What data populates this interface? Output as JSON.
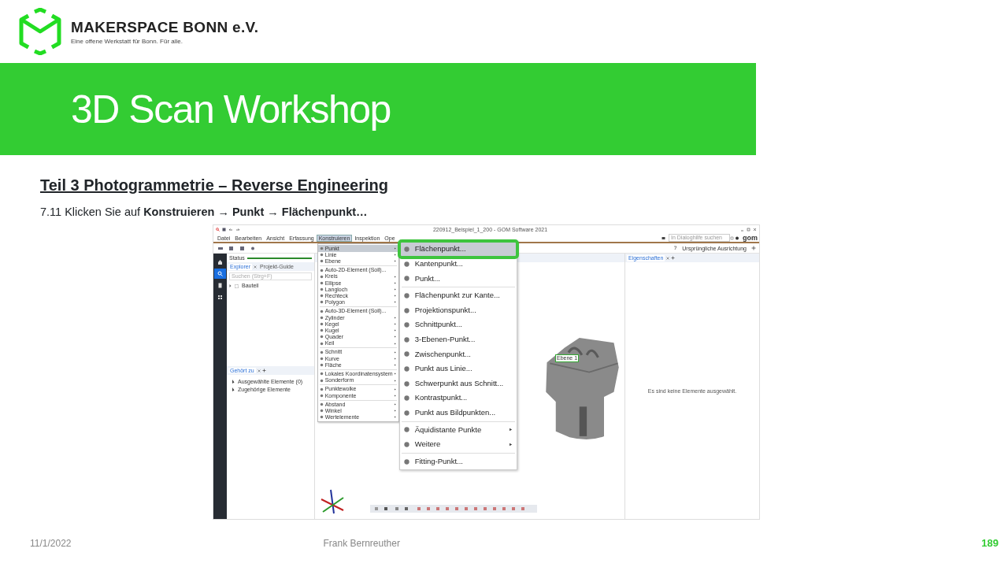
{
  "header": {
    "org_name": "MAKERSPACE BONN e.V.",
    "tagline": "Eine offene Werkstatt für Bonn. Für alle."
  },
  "banner": {
    "title": "3D Scan Workshop"
  },
  "section_heading": "Teil 3  Photogrammetrie  – Reverse Engineering",
  "instruction": "7.11 Klicken Sie auf **Konstruieren** → **Punkt** → **Flächenpunkt…**",
  "app": {
    "title": "220912_Beispiel_1_200 - GOM Software 2021",
    "menus": [
      {
        "label": "Datei",
        "selected": false
      },
      {
        "label": "Bearbeiten",
        "selected": false
      },
      {
        "label": "Ansicht",
        "selected": false
      },
      {
        "label": "Erfassung",
        "selected": false
      },
      {
        "label": "Konstruieren",
        "selected": true
      },
      {
        "label": "Inspektion",
        "selected": false
      },
      {
        "label": "Ope",
        "selected": false
      }
    ],
    "help_search": {
      "placeholder": "In Dialoghilfe suchen"
    },
    "brand": "gom",
    "alignment": "Ursprüngliche Ausrichtung",
    "sidebar": [
      {
        "kind": "home",
        "selected": false
      },
      {
        "kind": "search",
        "selected": true
      },
      {
        "kind": "document",
        "selected": false
      },
      {
        "kind": "grid",
        "selected": false
      }
    ],
    "status": {
      "label": "Status",
      "level": 1
    },
    "explorer_tabs": [
      {
        "label": "Explorer",
        "selected": true,
        "closable": true
      },
      {
        "label": "Projekt-Guide",
        "selected": false,
        "closable": false
      }
    ],
    "explorer_search": {
      "placeholder": "Suchen (Strg+F)"
    },
    "tree": [
      {
        "label": "Bauteil",
        "expanded": false
      }
    ],
    "related_tab": {
      "label": "Gehört zu"
    },
    "related_items": [
      "Ausgewählte Elemente (0)",
      "Zugehörige Elemente"
    ],
    "properties_tab": {
      "label": "Eigenschaften"
    },
    "properties_message": "Es sind keine Elemente ausgewählt.",
    "model_label": "Ebene 1",
    "construct_menu": [
      [
        {
          "label": "Punkt",
          "selected": true,
          "submenu": true
        },
        {
          "label": "Linie",
          "selected": false,
          "submenu": true
        },
        {
          "label": "Ebene",
          "selected": false,
          "submenu": true
        }
      ],
      [
        {
          "label": "Auto-2D-Element (Soll)...",
          "selected": false,
          "submenu": false
        },
        {
          "label": "Kreis",
          "selected": false,
          "submenu": true
        },
        {
          "label": "Ellipse",
          "selected": false,
          "submenu": true
        },
        {
          "label": "Langloch",
          "selected": false,
          "submenu": true
        },
        {
          "label": "Rechteck",
          "selected": false,
          "submenu": true
        },
        {
          "label": "Polygon",
          "selected": false,
          "submenu": true
        }
      ],
      [
        {
          "label": "Auto-3D-Element (Soll)...",
          "selected": false,
          "submenu": false
        },
        {
          "label": "Zylinder",
          "selected": false,
          "submenu": true
        },
        {
          "label": "Kegel",
          "selected": false,
          "submenu": true
        },
        {
          "label": "Kugel",
          "selected": false,
          "submenu": true
        },
        {
          "label": "Quader",
          "selected": false,
          "submenu": true
        },
        {
          "label": "Keil",
          "selected": false,
          "submenu": true
        }
      ],
      [
        {
          "label": "Schnitt",
          "selected": false,
          "submenu": true
        },
        {
          "label": "Kurve",
          "selected": false,
          "submenu": true
        },
        {
          "label": "Fläche",
          "selected": false,
          "submenu": true
        }
      ],
      [
        {
          "label": "Lokales Koordinatensystem",
          "selected": false,
          "submenu": true
        },
        {
          "label": "Sonderform",
          "selected": false,
          "submenu": true
        }
      ],
      [
        {
          "label": "Punktewolke",
          "selected": false,
          "submenu": true
        },
        {
          "label": "Komponente",
          "selected": false,
          "submenu": true
        }
      ],
      [
        {
          "label": "Abstand",
          "selected": false,
          "submenu": true
        },
        {
          "label": "Winkel",
          "selected": false,
          "submenu": true
        },
        {
          "label": "Wertelemente",
          "selected": false,
          "submenu": true
        }
      ]
    ],
    "point_menu": [
      [
        {
          "label": "Flächenpunkt...",
          "selected": true,
          "submenu": false
        },
        {
          "label": "Kantenpunkt...",
          "selected": false,
          "submenu": false
        },
        {
          "label": "Punkt...",
          "selected": false,
          "submenu": false
        }
      ],
      [
        {
          "label": "Flächenpunkt zur Kante...",
          "selected": false,
          "submenu": false
        },
        {
          "label": "Projektionspunkt...",
          "selected": false,
          "submenu": false
        },
        {
          "label": "Schnittpunkt...",
          "selected": false,
          "submenu": false
        },
        {
          "label": "3-Ebenen-Punkt...",
          "selected": false,
          "submenu": false
        },
        {
          "label": "Zwischenpunkt...",
          "selected": false,
          "submenu": false
        },
        {
          "label": "Punkt aus Linie...",
          "selected": false,
          "submenu": false
        },
        {
          "label": "Schwerpunkt aus Schnitt...",
          "selected": false,
          "submenu": false
        },
        {
          "label": "Kontrastpunkt...",
          "selected": false,
          "submenu": false
        },
        {
          "label": "Punkt aus Bildpunkten...",
          "selected": false,
          "submenu": false
        }
      ],
      [
        {
          "label": "Äquidistante Punkte",
          "selected": false,
          "submenu": true
        },
        {
          "label": "Weitere",
          "selected": false,
          "submenu": true
        }
      ],
      [
        {
          "label": "Fitting-Punkt...",
          "selected": false,
          "submenu": false
        }
      ]
    ]
  },
  "footer": {
    "date": "11/1/2022",
    "author": "Frank Bernreuther",
    "page": "189"
  }
}
